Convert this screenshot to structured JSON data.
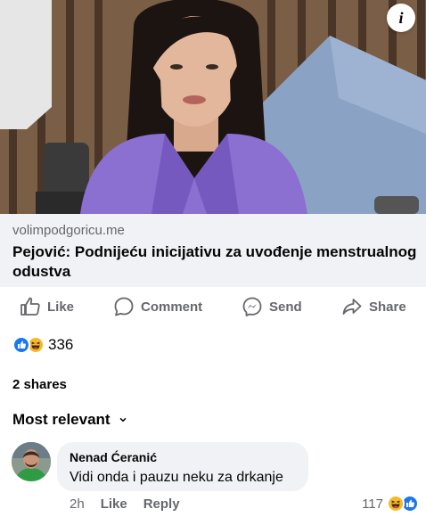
{
  "post": {
    "info_icon": "info-icon",
    "link": {
      "domain": "volimpodgoricu.me",
      "title": "Pejović: Podnijeću inicijativu za uvođenje menstrualnog odustva"
    },
    "actions": [
      {
        "label": "Like",
        "icon": "thumbs-up-icon"
      },
      {
        "label": "Comment",
        "icon": "comment-icon"
      },
      {
        "label": "Send",
        "icon": "messenger-icon"
      },
      {
        "label": "Share",
        "icon": "share-arrow-icon"
      }
    ],
    "reactions": {
      "count": "336",
      "types": [
        "like",
        "haha"
      ]
    },
    "shares": "2 shares",
    "comment_filter": "Most relevant"
  },
  "comment": {
    "author": "Nenad Ćeranić",
    "text": "Vidi onda i pauzu neku za drkanje",
    "time": "2h",
    "like_label": "Like",
    "reply_label": "Reply",
    "reaction_count": "117",
    "reaction_types": [
      "haha",
      "like"
    ]
  },
  "colors": {
    "secondary_text": "#65676b",
    "link_background": "#f0f2f5",
    "like_blue": "#1877f2",
    "haha_yellow": "#f7b928",
    "blazer_purple": "#8b6fd1"
  }
}
